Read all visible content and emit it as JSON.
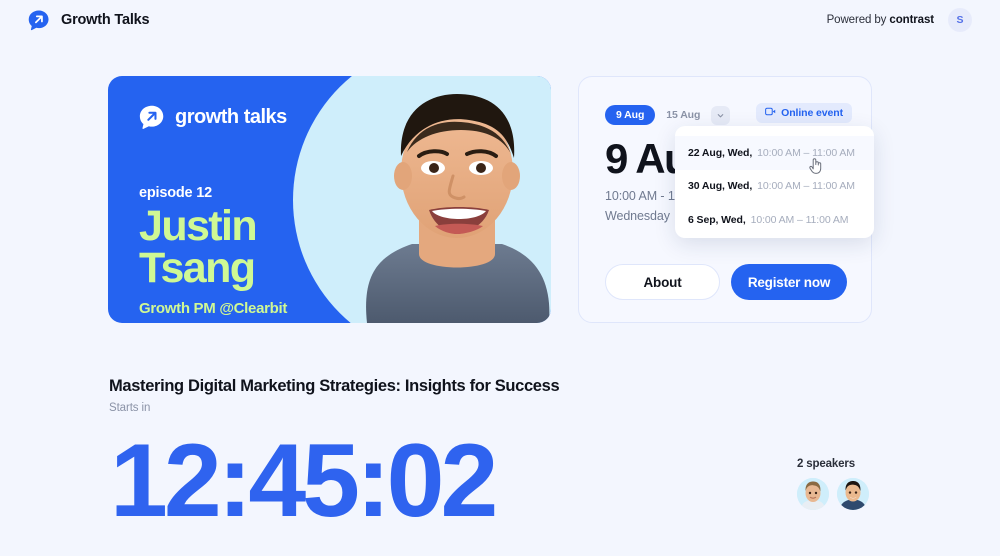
{
  "header": {
    "brand_name": "Growth Talks",
    "logo_icon": "growth-talks-bubble-arrow-icon",
    "powered_prefix": "Powered by ",
    "powered_brand": "contrast",
    "avatar_initial": "S"
  },
  "banner": {
    "logo_text": "growth talks",
    "logo_icon": "growth-talks-bubble-arrow-icon",
    "episode": "episode 12",
    "speaker_first": "Justin",
    "speaker_last": "Tsang",
    "speaker_role": "Growth PM @Clearbit",
    "bg_color": "#2563f0",
    "accent_color": "#cff894",
    "circle_color": "#cfeefb"
  },
  "info_card": {
    "chips": [
      {
        "label": "9 Aug",
        "active": true
      },
      {
        "label": "15 Aug",
        "active": false
      }
    ],
    "more_icon": "chevron-down-icon",
    "online_badge": {
      "icon": "video-camera-icon",
      "label": "Online event"
    },
    "date_big": "9 Aug",
    "time_range": "10:00 AM - 11:00 AM",
    "weekday": "Wednesday",
    "about_label": "About",
    "register_label": "Register now",
    "accent_color": "#2563f0"
  },
  "dropdown": {
    "items": [
      {
        "date": "22 Aug, Wed,",
        "time": "10:00 AM – 11:00 AM",
        "hover": true
      },
      {
        "date": "30 Aug, Wed,",
        "time": "10:00 AM – 11:00 AM",
        "hover": false
      },
      {
        "date": "6 Sep, Wed,",
        "time": "10:00 AM – 11:00 AM",
        "hover": false
      }
    ],
    "cursor_icon": "pointing-hand-cursor"
  },
  "event": {
    "title": "Mastering Digital Marketing Strategies: Insights for Success",
    "starts_in_label": "Starts in",
    "countdown": "12:45:02",
    "countdown_color": "#2f63ef"
  },
  "speakers": {
    "count_label": "2 speakers",
    "avatars": [
      "speaker-avatar-1",
      "speaker-avatar-2"
    ]
  }
}
